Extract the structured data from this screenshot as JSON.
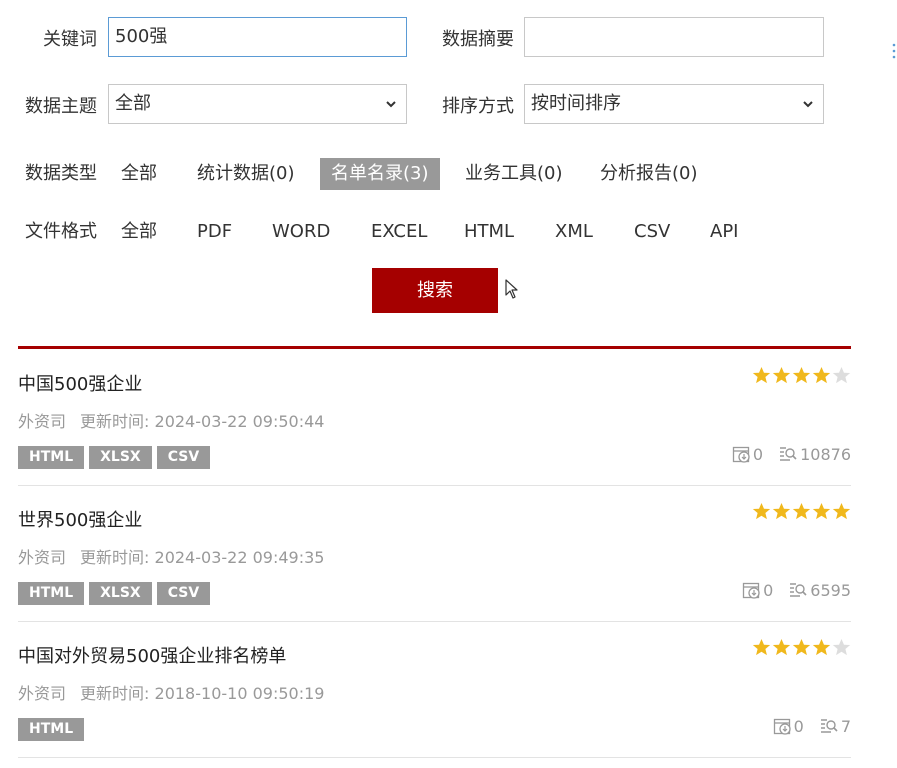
{
  "filters": {
    "keyword_label": "关键词",
    "keyword_value": "500强",
    "summary_label": "数据摘要",
    "summary_value": "",
    "topic_label": "数据主题",
    "topic_value": "全部",
    "sort_label": "排序方式",
    "sort_value": "按时间排序",
    "type_label": "数据类型",
    "types": [
      "全部",
      "统计数据(0)",
      "名单名录(3)",
      "业务工具(0)",
      "分析报告(0)"
    ],
    "type_selected": "名单名录(3)",
    "format_label": "文件格式",
    "formats": [
      "全部",
      "PDF",
      "WORD",
      "EXCEL",
      "HTML",
      "XML",
      "CSV",
      "API"
    ],
    "search_label": "搜索"
  },
  "results": [
    {
      "title": "中国500强企业",
      "source": "外资司",
      "updated_label": "更新时间:",
      "updated": "2024-03-22 09:50:44",
      "tags": [
        "HTML",
        "XLSX",
        "CSV"
      ],
      "rating": 4,
      "downloads": "0",
      "views": "10876"
    },
    {
      "title": "世界500强企业",
      "source": "外资司",
      "updated_label": "更新时间:",
      "updated": "2024-03-22 09:49:35",
      "tags": [
        "HTML",
        "XLSX",
        "CSV"
      ],
      "rating": 5,
      "downloads": "0",
      "views": "6595"
    },
    {
      "title": "中国对外贸易500强企业排名榜单",
      "source": "外资司",
      "updated_label": "更新时间:",
      "updated": "2018-10-10 09:50:19",
      "tags": [
        "HTML"
      ],
      "rating": 4,
      "downloads": "0",
      "views": "7"
    }
  ],
  "colors": {
    "accent": "#a50000",
    "tag_bg": "#999999",
    "star_on": "#f0b81c",
    "star_off": "#dddddd"
  },
  "icons": {
    "select": "chevron-down-icon",
    "download": "download-icon",
    "views": "view-search-icon",
    "rating": "star-icon",
    "pointer": "mouse-cursor-icon"
  }
}
